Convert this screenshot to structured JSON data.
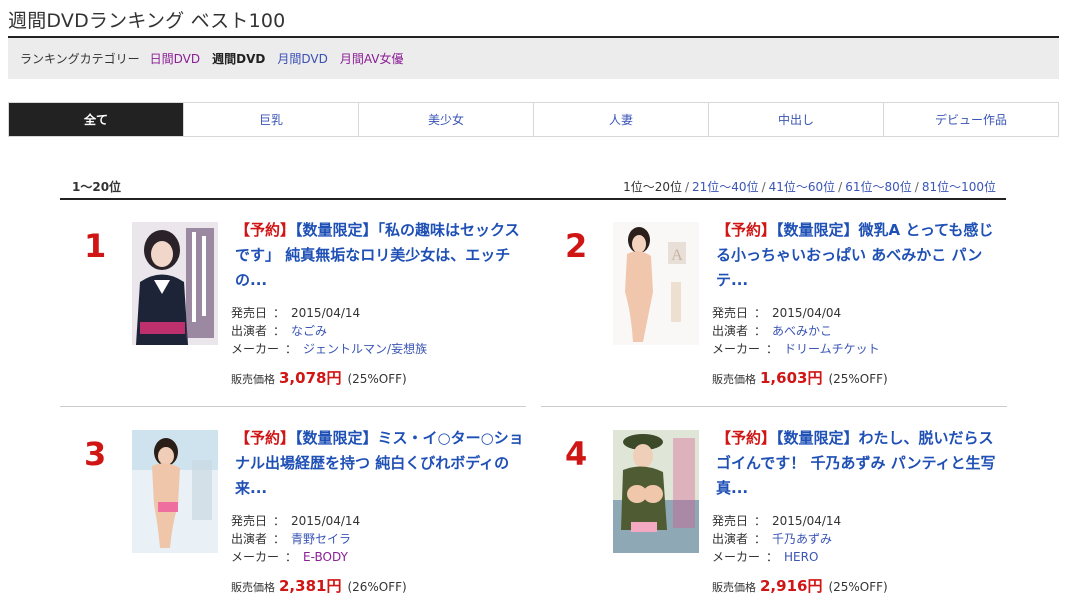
{
  "page": {
    "title": "週間DVDランキング ベスト100"
  },
  "categories": {
    "label": "ランキングカテゴリー",
    "links": [
      {
        "label": "日間DVD"
      },
      {
        "label": "週間DVD"
      },
      {
        "label": "月間DVD"
      },
      {
        "label": "月間AV女優"
      }
    ]
  },
  "genres": [
    {
      "label": "全て"
    },
    {
      "label": "巨乳"
    },
    {
      "label": "美少女"
    },
    {
      "label": "人妻"
    },
    {
      "label": "中出し"
    },
    {
      "label": "デビュー作品"
    }
  ],
  "range": {
    "current": "1〜20位",
    "pages": [
      {
        "label": "1位〜20位"
      },
      {
        "label": "21位〜40位"
      },
      {
        "label": "41位〜60位"
      },
      {
        "label": "61位〜80位"
      },
      {
        "label": "81位〜100位"
      }
    ]
  },
  "labels": {
    "release": "発売日",
    "performer": "出演者",
    "maker": "メーカー",
    "price": "販売価格",
    "colon": "："
  },
  "items": [
    {
      "rank": "1",
      "tag": "【予約】",
      "title": "【数量限定】「私の趣味はセックスです」 純真無垢なロリ美少女は、エッチの...",
      "release": "2015/04/14",
      "performer": "なごみ",
      "maker": "ジェントルマン/妄想族",
      "price": "3,078円",
      "off": "(25%OFF)"
    },
    {
      "rank": "2",
      "tag": "【予約】",
      "title": "【数量限定】微乳A とっても感じる小っちゃいおっぱい あべみかこ パンテ...",
      "release": "2015/04/04",
      "performer": "あべみかこ",
      "maker": "ドリームチケット",
      "price": "1,603円",
      "off": "(25%OFF)"
    },
    {
      "rank": "3",
      "tag": "【予約】",
      "title": "【数量限定】ミス・イ○ター○ショナル出場経歴を持つ 純白くびれボディの来...",
      "release": "2015/04/14",
      "performer": "青野セイラ",
      "maker": "E-BODY",
      "price": "2,381円",
      "off": "(26%OFF)"
    },
    {
      "rank": "4",
      "tag": "【予約】",
      "title": "【数量限定】わたし、脱いだらスゴイんです！ 千乃あずみ パンティと生写真...",
      "release": "2015/04/14",
      "performer": "千乃あずみ",
      "maker": "HERO",
      "price": "2,916円",
      "off": "(25%OFF)"
    }
  ],
  "colors": {
    "rank": "#d01515",
    "title_link": "#1f50b5",
    "link": "#3a55b5",
    "visited": "#8b1e97",
    "active_tab": "#222222"
  }
}
